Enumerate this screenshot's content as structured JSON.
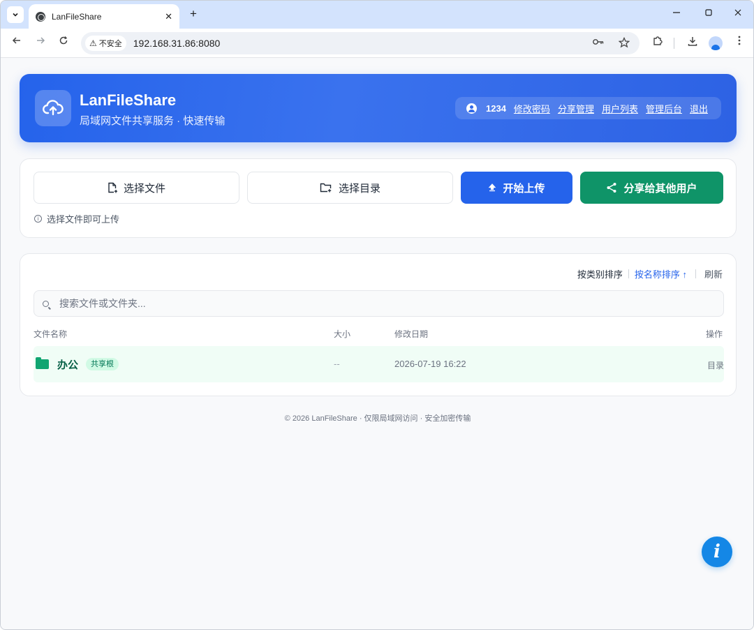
{
  "browser": {
    "tab_title": "LanFileShare",
    "tab_close": "✕",
    "new_tab": "+",
    "insecure_label": "不安全",
    "url": "192.168.31.86:8080"
  },
  "hero": {
    "title": "LanFileShare",
    "subtitle": "局域网文件共享服务 · 快速传输",
    "username": "1234",
    "links": [
      "修改密码",
      "分享管理",
      "用户列表",
      "管理后台",
      "退出"
    ]
  },
  "upload": {
    "select_file": "选择文件",
    "select_dir": "选择目录",
    "start_upload": "开始上传",
    "share_to_users": "分享给其他用户",
    "hint": "选择文件即可上传"
  },
  "list": {
    "sort_by_type": "按类别排序",
    "sort_by_name": "按名称排序 ↑",
    "refresh": "刷新",
    "search_placeholder": "搜索文件或文件夹...",
    "columns": {
      "name": "文件名称",
      "size": "大小",
      "date": "修改日期",
      "action": "操作"
    },
    "rows": [
      {
        "name": "办公",
        "badge": "共享根",
        "size": "--",
        "date": "2026-07-19 16:22",
        "action": "目录"
      }
    ]
  },
  "footer": "© 2026 LanFileShare · 仅限局域网访问 · 安全加密传输",
  "fab_label": "i",
  "colors": {
    "primary": "#2563eb",
    "success": "#0f9468",
    "folder": "#10a571",
    "fab": "#1487e6"
  }
}
